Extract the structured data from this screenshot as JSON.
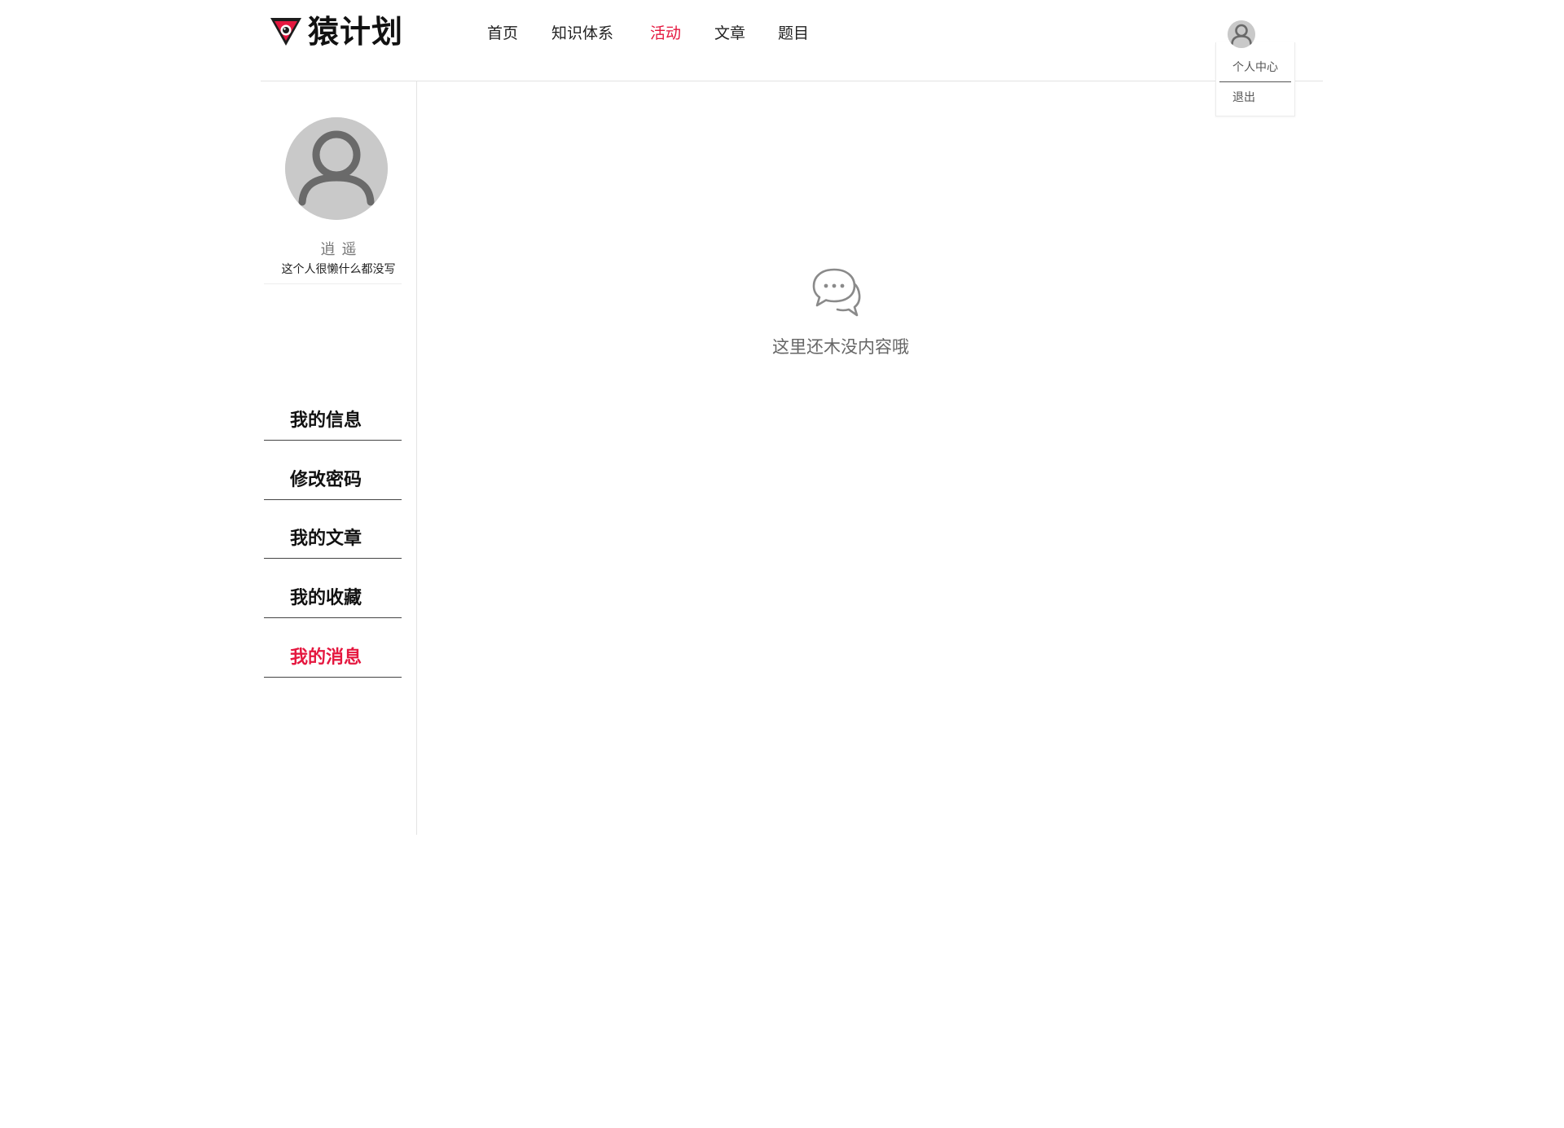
{
  "brand": {
    "name": "猿计划",
    "accent_color": "#e5173f",
    "logo_icon": "shield-logo-icon"
  },
  "nav": {
    "items": [
      {
        "label": "首页",
        "active": false
      },
      {
        "label": "知识体系",
        "active": false
      },
      {
        "label": "活动",
        "active": true
      },
      {
        "label": "文章",
        "active": false
      },
      {
        "label": "题目",
        "active": false
      }
    ]
  },
  "user_menu": {
    "avatar_icon": "user-avatar-icon",
    "items": [
      "个人中心",
      "退出"
    ]
  },
  "profile": {
    "name": "逍遥",
    "bio": "这个人很懒什么都没写",
    "avatar_icon": "user-avatar-icon"
  },
  "sidebar": {
    "items": [
      {
        "label": "我的信息",
        "active": false
      },
      {
        "label": "修改密码",
        "active": false
      },
      {
        "label": "我的文章",
        "active": false
      },
      {
        "label": "我的收藏",
        "active": false
      },
      {
        "label": "我的消息",
        "active": true
      }
    ]
  },
  "main": {
    "empty_icon": "chat-bubbles-icon",
    "empty_text": "这里还木没内容哦"
  }
}
